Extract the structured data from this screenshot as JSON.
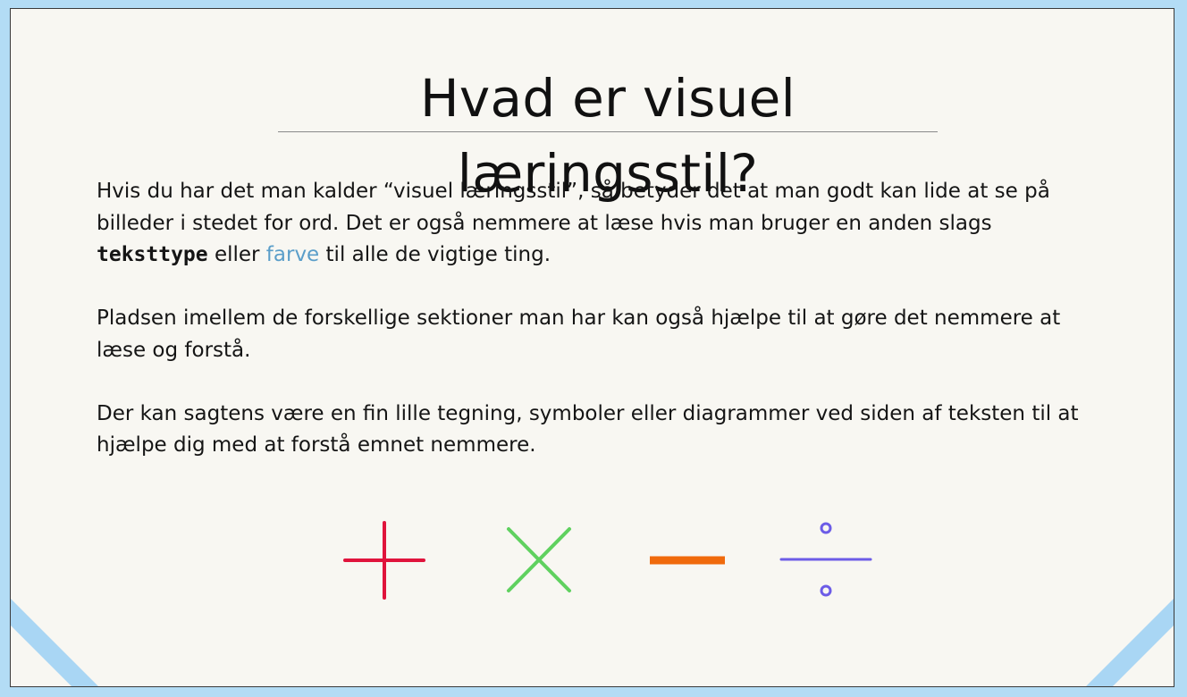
{
  "slide": {
    "title": "Hvad er visuel læringsstil?",
    "paragraph1": {
      "intro": "Hvis du har det man kalder “visuel læringsstil”, så betyder det at man godt kan lide at se på billeder i stedet for ord. Det er også nemmere at læse hvis man bruger en anden slags",
      "font_word": "teksttype",
      "middle": "eller",
      "color_word": "farve",
      "end": "til alle de vigtige ting."
    },
    "paragraph2": "Pladsen imellem de forskellige sektioner man har kan også hjælpe til at gøre det nemmere at læse og forstå.",
    "paragraph3": "Der kan sagtens være en fin lille tegning, symboler eller diagrammer ved siden af teksten til at hjælpe dig med at forstå emnet nemmere."
  },
  "symbols": [
    {
      "name": "plus-icon",
      "color": "#e0143c"
    },
    {
      "name": "multiply-icon",
      "color": "#5fd15f"
    },
    {
      "name": "minus-icon",
      "color": "#f06a0c"
    },
    {
      "name": "divide-icon",
      "color": "#6c5ce7"
    }
  ],
  "colors": {
    "background": "#b3dcf5",
    "slide": "#f8f7f2",
    "highlight_word": "#5b9ec9",
    "corner_accent": "#a9d6f4"
  }
}
